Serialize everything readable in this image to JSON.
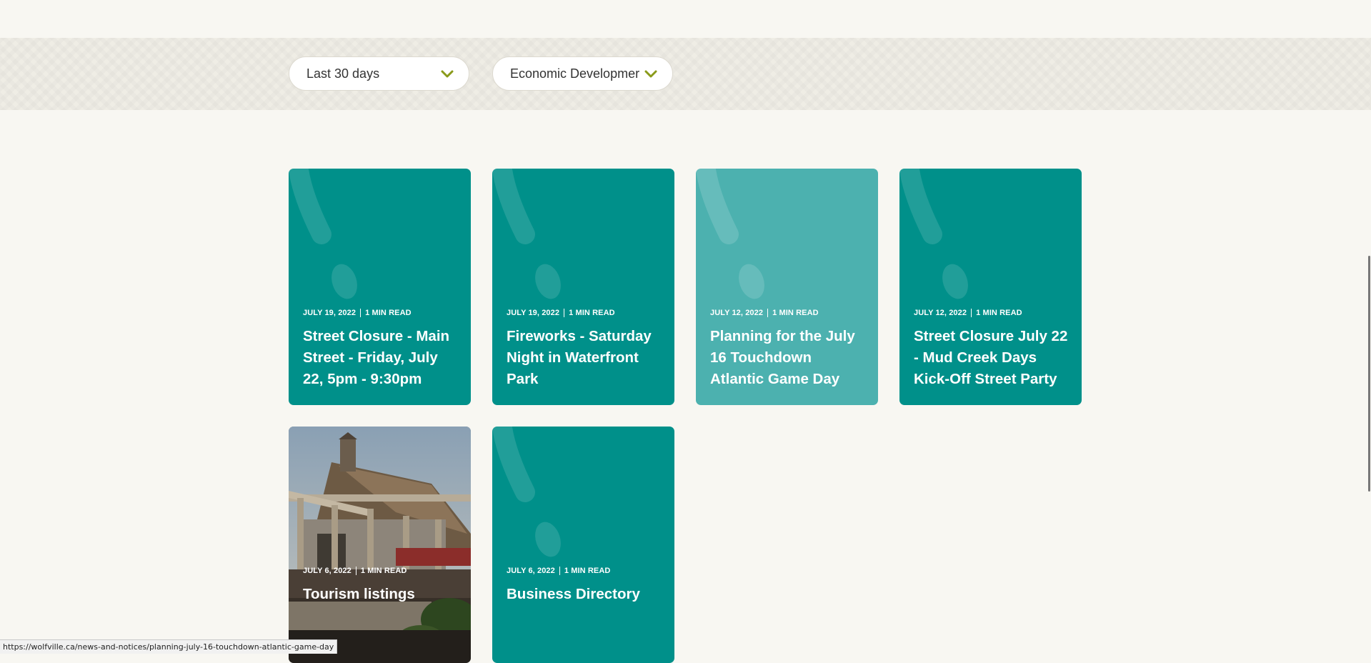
{
  "filters": {
    "date": {
      "selected": "Last 30 days"
    },
    "category": {
      "selected": "Economic Developmer"
    }
  },
  "cards": [
    {
      "date": "JULY 19, 2022",
      "read_time": "1 MIN READ",
      "title": "Street Closure - Main Street - Friday, July 22, 5pm - 9:30pm"
    },
    {
      "date": "JULY 19, 2022",
      "read_time": "1 MIN READ",
      "title": "Fireworks - Saturday Night in Waterfront Park"
    },
    {
      "date": "JULY 12, 2022",
      "read_time": "1 MIN READ",
      "title": "Planning for the July 16 Touchdown Atlantic Game Day"
    },
    {
      "date": "JULY 12, 2022",
      "read_time": "1 MIN READ",
      "title": "Street Closure July 22 - Mud Creek Days Kick-Off Street Party"
    },
    {
      "date": "JULY 6, 2022",
      "read_time": "1 MIN READ",
      "title": "Tourism listings"
    },
    {
      "date": "JULY 6, 2022",
      "read_time": "1 MIN READ",
      "title": "Business Directory"
    }
  ],
  "status_bar": {
    "url": "https://wolfville.ca/news-and-notices/planning-july-16-touchdown-atlantic-game-day"
  },
  "colors": {
    "card_teal": "#00908a",
    "card_hover": "#4cb1af",
    "chevron": "#8a9a1a",
    "background": "#f8f7f2"
  },
  "icons": {
    "dropdown": "chevron-down-icon",
    "card_decoration": "exclamation-decoration"
  }
}
